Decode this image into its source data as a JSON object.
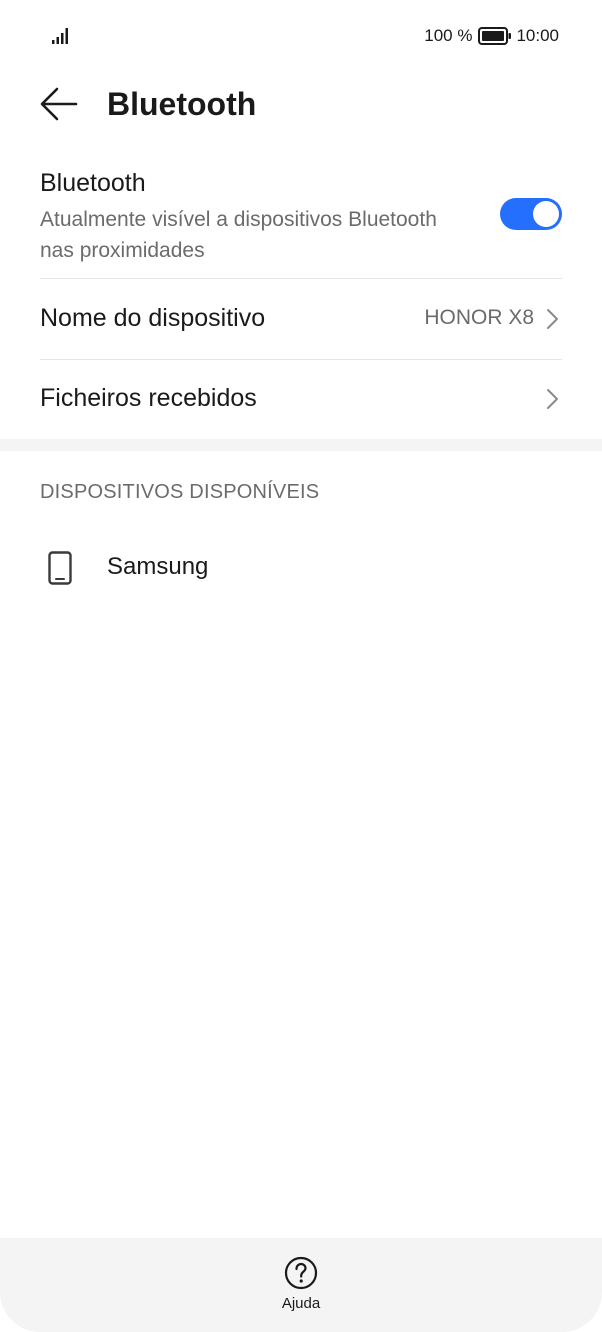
{
  "status_bar": {
    "signal_icon": "signal-icon",
    "battery_percent": "100 %",
    "battery_icon": "battery-icon",
    "time": "10:00"
  },
  "header": {
    "back_icon": "arrow-left-icon",
    "title": "Bluetooth"
  },
  "bluetooth": {
    "title": "Bluetooth",
    "subtitle": "Atualmente visível a dispositivos Bluetooth nas proximidades",
    "toggle_on": true,
    "accent_color": "#256fff"
  },
  "device_name_row": {
    "label": "Nome do dispositivo",
    "value": "HONOR X8"
  },
  "received_files_row": {
    "label": "Ficheiros recebidos"
  },
  "available_section": {
    "header": "DISPOSITIVOS DISPONÍVEIS",
    "devices": [
      {
        "name": "Samsung",
        "icon": "phone-icon"
      }
    ]
  },
  "bottom_bar": {
    "help_icon": "help-circle-icon",
    "help_label": "Ajuda"
  }
}
